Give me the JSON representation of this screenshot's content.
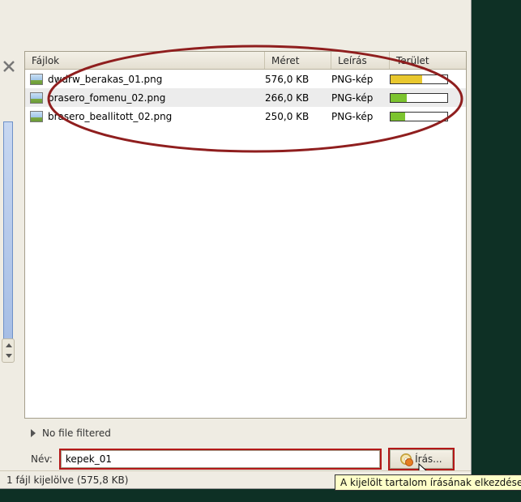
{
  "columns": {
    "files": "Fájlok",
    "size": "Méret",
    "desc": "Leírás",
    "area": "Terület"
  },
  "rows": [
    {
      "name": "dwdrw_berakas_01.png",
      "size": "576,0 KB",
      "desc": "PNG-kép",
      "bar_color": "yellow",
      "bar_pct": 55
    },
    {
      "name": "brasero_fomenu_02.png",
      "size": "266,0 KB",
      "desc": "PNG-kép",
      "bar_color": "green",
      "bar_pct": 28
    },
    {
      "name": "brasero_beallitott_02.png",
      "size": "250,0 KB",
      "desc": "PNG-kép",
      "bar_color": "green",
      "bar_pct": 26
    }
  ],
  "selected_row_index": 1,
  "filter_text": "No file filtered",
  "name_label": "Név:",
  "name_value": "kepek_01",
  "write_label": "Írás...",
  "tooltip": "A kijelölt tartalom írásának elkezdése",
  "status": "1 fájl kijelölve (575,8 KB)"
}
